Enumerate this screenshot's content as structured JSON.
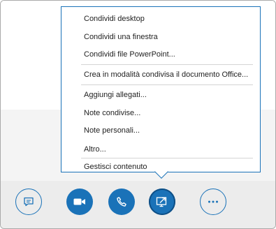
{
  "share_menu": {
    "items": [
      {
        "label": "Condividi desktop"
      },
      {
        "label": "Condividi una finestra"
      },
      {
        "label": "Condividi file PowerPoint..."
      },
      {
        "label": "Crea in modalità condivisa il documento Office..."
      },
      {
        "label": "Aggiungi allegati..."
      },
      {
        "label": "Note condivise..."
      },
      {
        "label": "Note personali..."
      },
      {
        "label": "Altro..."
      },
      {
        "label": "Gestisci contenuto"
      }
    ]
  },
  "toolbar": {
    "buttons": [
      {
        "icon": "chat-bubble-icon",
        "style": "outline"
      },
      {
        "icon": "video-camera-icon",
        "style": "filled"
      },
      {
        "icon": "phone-icon",
        "style": "filled"
      },
      {
        "icon": "present-screen-icon",
        "style": "filled-active"
      },
      {
        "icon": "ellipsis-icon",
        "style": "outline"
      }
    ]
  },
  "colors": {
    "accent": "#1a72b8",
    "toolbar_bg": "#ececec",
    "lower_bg": "#f4f4f4"
  }
}
